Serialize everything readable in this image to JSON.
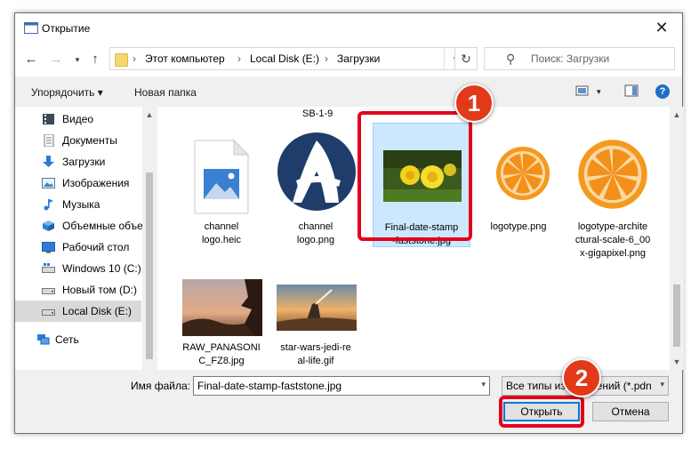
{
  "window": {
    "title": "Открытие"
  },
  "address": {
    "parts": [
      "Этот компьютер",
      "Local Disk (E:)",
      "Загрузки"
    ],
    "search_placeholder": "Поиск: Загрузки"
  },
  "toolbar": {
    "organize_label": "Упорядочить ▾",
    "new_folder_label": "Новая папка"
  },
  "sidebar": {
    "items": [
      {
        "label": "Видео",
        "icon": "video-icon"
      },
      {
        "label": "Документы",
        "icon": "documents-icon"
      },
      {
        "label": "Загрузки",
        "icon": "downloads-icon"
      },
      {
        "label": "Изображения",
        "icon": "pictures-icon"
      },
      {
        "label": "Музыка",
        "icon": "music-icon"
      },
      {
        "label": "Объемные объе",
        "icon": "3d-objects-icon"
      },
      {
        "label": "Рабочий стол",
        "icon": "desktop-icon"
      },
      {
        "label": "Windows 10 (C:)",
        "icon": "drive-icon"
      },
      {
        "label": "Новый том (D:)",
        "icon": "drive-icon"
      },
      {
        "label": "Local Disk (E:)",
        "icon": "drive-icon",
        "selected": true
      },
      {
        "label": "Сеть",
        "icon": "network-icon"
      }
    ]
  },
  "files": {
    "partial_label": "SB-1-9",
    "items": [
      {
        "name_line1": "channel",
        "name_line2": "logo.heic"
      },
      {
        "name_line1": "channel",
        "name_line2": "logo.png"
      },
      {
        "name_line1": "Final-date-stamp",
        "name_line2": "-faststone.jpg",
        "selected": true
      },
      {
        "name_line1": "logotype.png",
        "name_line2": ""
      },
      {
        "name_line1": "logotype-archite",
        "name_line2": "ctural-scale-6_00",
        "name_line3": "x-gigapixel.png"
      },
      {
        "name_line1": "RAW_PANASONI",
        "name_line2": "C_FZ8.jpg"
      },
      {
        "name_line1": "star-wars-jedi-re",
        "name_line2": "al-life.gif"
      }
    ]
  },
  "bottom": {
    "filename_label": "Имя файла:",
    "filename_value": "Final-date-stamp-faststone.jpg",
    "filetype_value": "Все типы изображений (*.pdn",
    "open_label": "Открыть",
    "cancel_label": "Отмена"
  },
  "annotations": {
    "badge1": "1",
    "badge2": "2"
  },
  "colors": {
    "accent": "#0078d7",
    "callout": "#e3001b",
    "badge": "#e23a18",
    "selected": "#cce8ff"
  }
}
